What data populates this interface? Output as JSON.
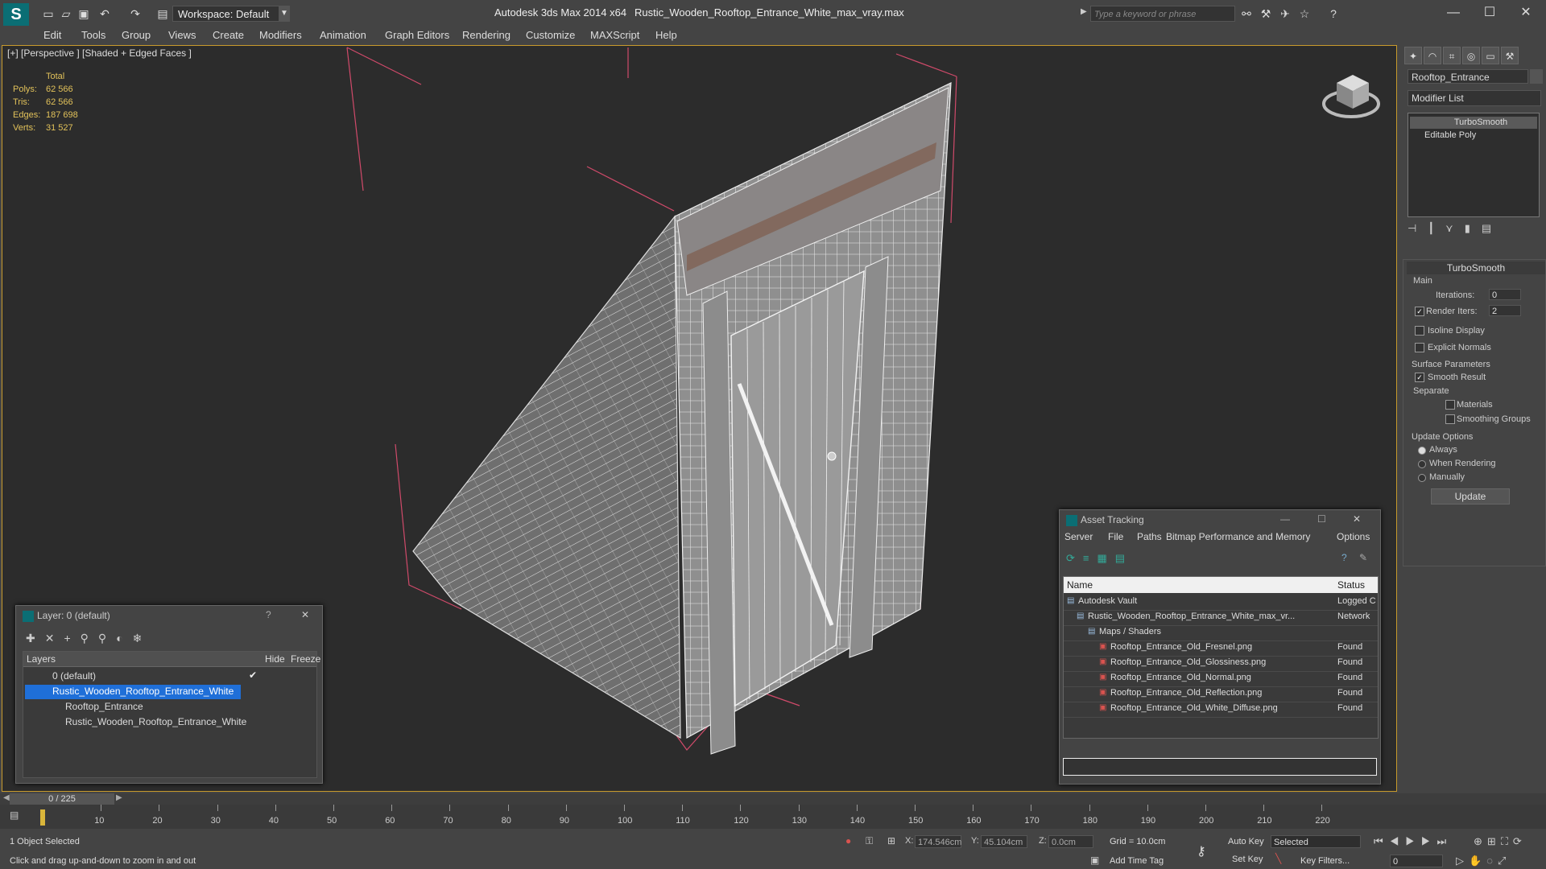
{
  "titlebar": {
    "logo": "S",
    "workspace_label": "Workspace: Default",
    "app_title": "Autodesk 3ds Max  2014 x64",
    "file_name": "Rustic_Wooden_Rooftop_Entrance_White_max_vray.max",
    "search_placeholder": "Type a keyword or phrase",
    "window_controls": [
      "—",
      "☐",
      "✕"
    ]
  },
  "menu": [
    "Edit",
    "Tools",
    "Group",
    "Views",
    "Create",
    "Modifiers",
    "Animation",
    "Graph Editors",
    "Rendering",
    "Customize",
    "MAXScript",
    "Help"
  ],
  "viewport": {
    "label": "[+] [Perspective ] [Shaded + Edged Faces ]",
    "stats": {
      "header": "Total",
      "rows": [
        {
          "label": "Polys:",
          "value": "62 566"
        },
        {
          "label": "Tris:",
          "value": "62 566"
        },
        {
          "label": "Edges:",
          "value": "187 698"
        },
        {
          "label": "Verts:",
          "value": "31 527"
        }
      ]
    }
  },
  "command_panel": {
    "object_name": "Rooftop_Entrance",
    "modifier_list": "Modifier List",
    "stack": [
      "TurboSmooth",
      "Editable Poly"
    ],
    "turbosmooth": {
      "title": "TurboSmooth",
      "main": "Main",
      "iterations_label": "Iterations:",
      "iterations_value": "0",
      "render_iters_label": "Render Iters:",
      "render_iters_value": "2",
      "isoline": "Isoline Display",
      "explicit_normals": "Explicit Normals",
      "surface_params": "Surface Parameters",
      "smooth_result": "Smooth Result",
      "separate": "Separate",
      "materials": "Materials",
      "smoothing_groups": "Smoothing Groups",
      "update_options": "Update Options",
      "always": "Always",
      "when_rendering": "When Rendering",
      "manually": "Manually",
      "update_button": "Update"
    }
  },
  "layer_panel": {
    "title": "Layer: 0 (default)",
    "help": "?",
    "close": "✕",
    "columns": [
      "Layers",
      "Hide",
      "Freeze"
    ],
    "rows": [
      {
        "name": "0 (default)",
        "level": 0,
        "selected": false
      },
      {
        "name": "Rustic_Wooden_Rooftop_Entrance_White",
        "level": 0,
        "selected": true
      },
      {
        "name": "Rooftop_Entrance",
        "level": 1,
        "selected": false
      },
      {
        "name": "Rustic_Wooden_Rooftop_Entrance_White",
        "level": 1,
        "selected": false
      }
    ]
  },
  "asset_panel": {
    "title": "Asset Tracking",
    "menu": [
      "Server",
      "File",
      "Paths",
      "Bitmap Performance and Memory",
      "Options"
    ],
    "columns": [
      "Name",
      "Status"
    ],
    "rows": [
      {
        "name": "Autodesk Vault",
        "status": "Logged C",
        "level": 0
      },
      {
        "name": "Rustic_Wooden_Rooftop_Entrance_White_max_vr...",
        "status": "Network",
        "level": 1
      },
      {
        "name": "Maps / Shaders",
        "status": "",
        "level": 2
      },
      {
        "name": "Rooftop_Entrance_Old_Fresnel.png",
        "status": "Found",
        "level": 3
      },
      {
        "name": "Rooftop_Entrance_Old_Glossiness.png",
        "status": "Found",
        "level": 3
      },
      {
        "name": "Rooftop_Entrance_Old_Normal.png",
        "status": "Found",
        "level": 3
      },
      {
        "name": "Rooftop_Entrance_Old_Reflection.png",
        "status": "Found",
        "level": 3
      },
      {
        "name": "Rooftop_Entrance_Old_White_Diffuse.png",
        "status": "Found",
        "level": 3
      }
    ]
  },
  "timeline": {
    "frame_display": "0 / 225",
    "ticks": [
      "10",
      "20",
      "30",
      "40",
      "50",
      "60",
      "70",
      "80",
      "90",
      "100",
      "110",
      "120",
      "130",
      "140",
      "150",
      "160",
      "170",
      "180",
      "190",
      "200",
      "210",
      "220"
    ]
  },
  "status": {
    "selection": "1 Object Selected",
    "prompt": "Click and drag up-and-down to zoom in and out",
    "x_label": "X:",
    "x_value": "174.546cm",
    "y_label": "Y:",
    "y_value": "45.104cm",
    "z_label": "Z:",
    "z_value": "0.0cm",
    "grid": "Grid = 10.0cm",
    "add_time_tag": "Add Time Tag",
    "auto_key": "Auto Key",
    "set_key": "Set Key",
    "selected_dropdown": "Selected",
    "key_filters": "Key Filters...",
    "frame_field": "0"
  },
  "colors": {
    "accent": "#1f6fd8",
    "viewport_border": "#c89a2c",
    "stats": "#e2c25a",
    "bbox": "#d04a6a"
  }
}
